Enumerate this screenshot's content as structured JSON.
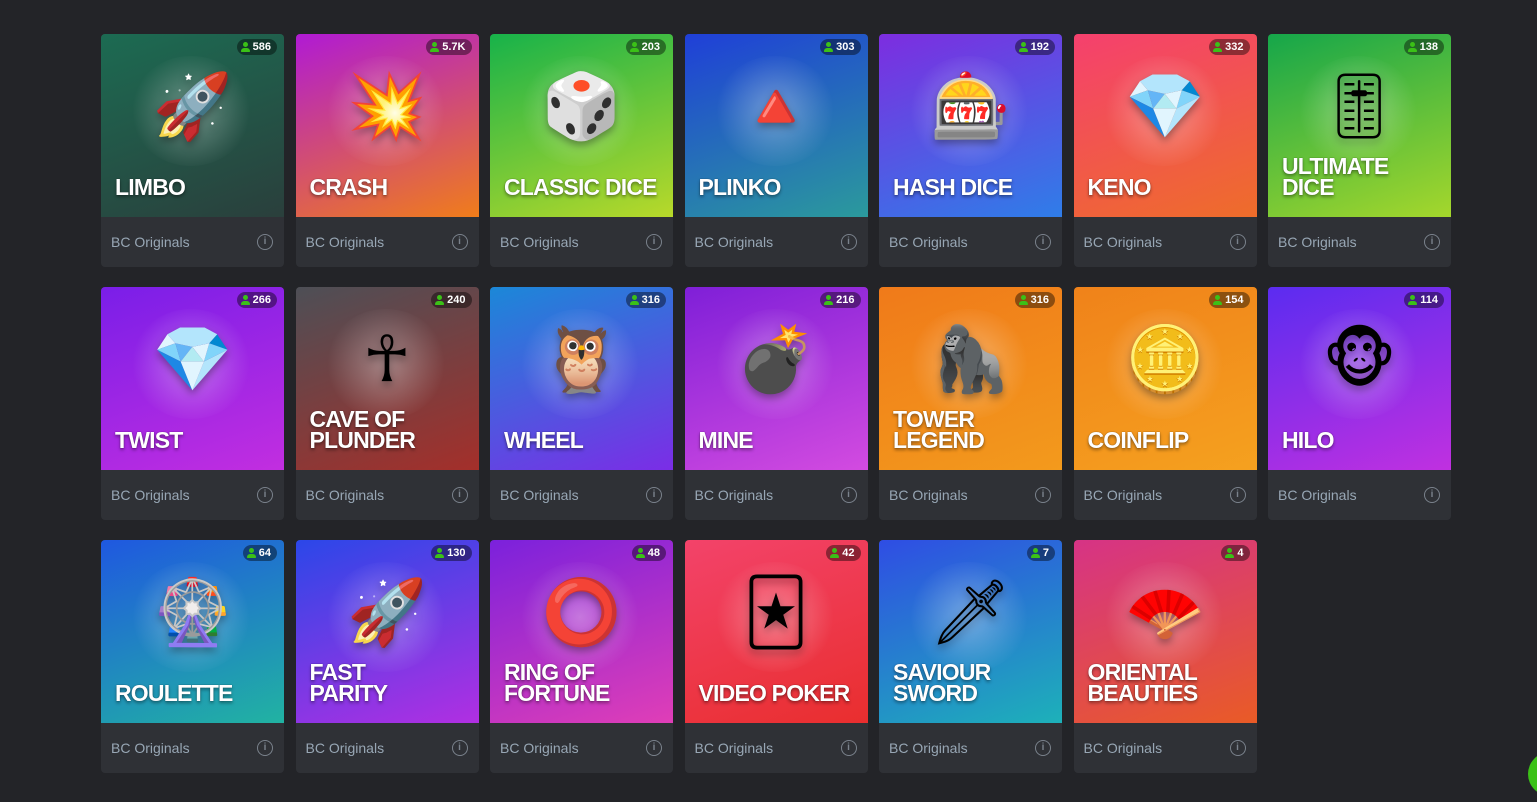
{
  "colors": {
    "page_background": "#232428",
    "card_footer": "#2f3136",
    "accent_green": "#3bc117",
    "provider_text": "#98a7b5"
  },
  "games": [
    {
      "name": "LIMBO",
      "players": "586",
      "provider": "BC Originals",
      "icon": "rocket",
      "glyph": "🚀",
      "bg": [
        "#1c6b52",
        "#2a3f3c"
      ]
    },
    {
      "name": "CRASH",
      "players": "5.7K",
      "provider": "BC Originals",
      "icon": "explosion",
      "glyph": "💥",
      "bg": [
        "#b01ad4",
        "#f07d1a"
      ]
    },
    {
      "name": "CLASSIC DICE",
      "players": "203",
      "provider": "BC Originals",
      "icon": "dice",
      "glyph": "🎲",
      "bg": [
        "#17b24a",
        "#b8d92a"
      ]
    },
    {
      "name": "PLINKO",
      "players": "303",
      "provider": "BC Originals",
      "icon": "plinko-triangle",
      "glyph": "🔺",
      "bg": [
        "#1f3fd8",
        "#2b9a9c"
      ]
    },
    {
      "name": "HASH DICE",
      "players": "192",
      "provider": "BC Originals",
      "icon": "slot-machine",
      "glyph": "🎰",
      "bg": [
        "#7d2de0",
        "#2f7de8"
      ]
    },
    {
      "name": "KENO",
      "players": "332",
      "provider": "BC Originals",
      "icon": "keno-gem",
      "glyph": "💎",
      "bg": [
        "#f5406e",
        "#ee6d2a"
      ]
    },
    {
      "name": "ULTIMATE\nDICE",
      "players": "138",
      "provider": "BC Originals",
      "icon": "dice-slider",
      "glyph": "🎚",
      "bg": [
        "#15a64a",
        "#a5d72c"
      ]
    },
    {
      "name": "TWIST",
      "players": "266",
      "provider": "BC Originals",
      "icon": "diamond",
      "glyph": "💎",
      "bg": [
        "#7a1ee8",
        "#c22ee0"
      ]
    },
    {
      "name": "CAVE OF\nPLUNDER",
      "players": "240",
      "provider": "BC Originals",
      "icon": "ankh-key",
      "glyph": "☥",
      "bg": [
        "#4d4f56",
        "#a42f2a"
      ]
    },
    {
      "name": "WHEEL",
      "players": "316",
      "provider": "BC Originals",
      "icon": "wheel-owl",
      "glyph": "🦉",
      "bg": [
        "#1b88d8",
        "#7b2de6"
      ]
    },
    {
      "name": "MINE",
      "players": "216",
      "provider": "BC Originals",
      "icon": "bomb",
      "glyph": "💣",
      "bg": [
        "#7f1fd8",
        "#d34be0"
      ]
    },
    {
      "name": "TOWER\nLEGEND",
      "players": "316",
      "provider": "BC Originals",
      "icon": "gorilla-tower",
      "glyph": "🦍",
      "bg": [
        "#f07a1a",
        "#f39a1c"
      ]
    },
    {
      "name": "COINFLIP",
      "players": "154",
      "provider": "BC Originals",
      "icon": "coin",
      "glyph": "🪙",
      "bg": [
        "#f0821a",
        "#f5a11f"
      ]
    },
    {
      "name": "HILO",
      "players": "114",
      "provider": "BC Originals",
      "icon": "monkey",
      "glyph": "🐵",
      "bg": [
        "#5b2cf0",
        "#c030e0"
      ]
    },
    {
      "name": "ROULETTE",
      "players": "64",
      "provider": "BC Originals",
      "icon": "roulette-wheel",
      "glyph": "🎡",
      "bg": [
        "#1f58e0",
        "#21b3a2"
      ]
    },
    {
      "name": "FAST\nPARITY",
      "players": "130",
      "provider": "BC Originals",
      "icon": "rocket",
      "glyph": "🚀",
      "bg": [
        "#2b47e8",
        "#b12fe2"
      ]
    },
    {
      "name": "RING OF\nFORTUNE",
      "players": "48",
      "provider": "BC Originals",
      "icon": "ring",
      "glyph": "⭕",
      "bg": [
        "#7b21dc",
        "#e03eb7"
      ]
    },
    {
      "name": "VIDEO POKER",
      "players": "42",
      "provider": "BC Originals",
      "icon": "playing-cards",
      "glyph": "🃏",
      "bg": [
        "#f3436a",
        "#e92e2e"
      ]
    },
    {
      "name": "SAVIOUR\nSWORD",
      "players": "7",
      "provider": "BC Originals",
      "icon": "sword",
      "glyph": "🗡",
      "bg": [
        "#2f4de4",
        "#1db1b9"
      ]
    },
    {
      "name": "ORIENTAL\nBEAUTIES",
      "players": "4",
      "provider": "BC Originals",
      "icon": "fan-flower",
      "glyph": "🪭",
      "bg": [
        "#d63386",
        "#e95b26"
      ]
    }
  ]
}
